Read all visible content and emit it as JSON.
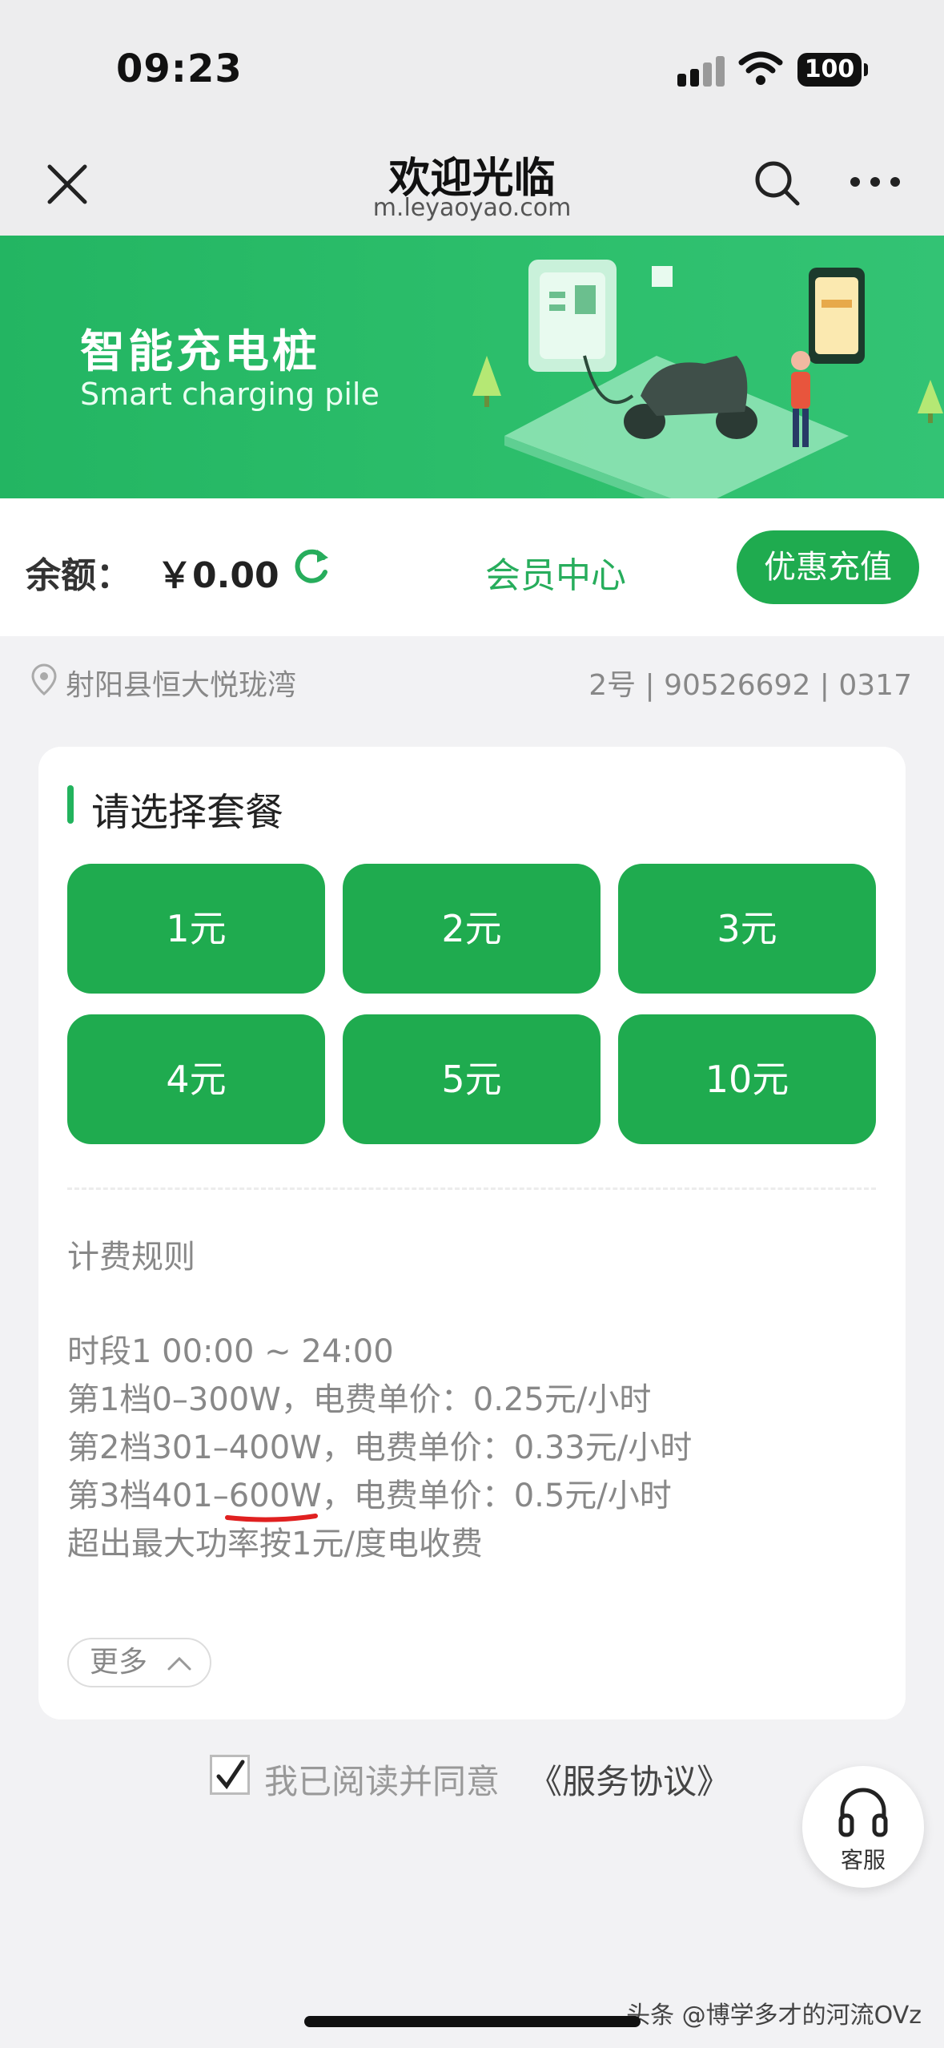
{
  "status_bar": {
    "time": "09:23",
    "battery": "100"
  },
  "nav": {
    "title": "欢迎光临",
    "url": "m.leyaoyao.com"
  },
  "banner": {
    "title": "智能充电桩",
    "subtitle": "Smart charging pile"
  },
  "balance": {
    "label": "余额：",
    "value": "￥0.00",
    "member_center": "会员中心",
    "recharge": "优惠充值"
  },
  "location": {
    "name": "射阳县恒大悦珑湾",
    "device": "2号 | 90526692 | 0317"
  },
  "packages": {
    "title": "请选择套餐",
    "items": [
      "1元",
      "2元",
      "3元",
      "4元",
      "5元",
      "10元"
    ]
  },
  "rules": {
    "title": "计费规则",
    "lines": [
      "时段1 00:00 ~ 24:00",
      "第1档0–300W，电费单价：0.25元/小时",
      "第2档301–400W，电费单价：0.33元/小时",
      "第3档401–600W，电费单价：0.5元/小时",
      "超出最大功率按1元/度电收费"
    ],
    "more": "更多"
  },
  "agreement": {
    "text": "我已阅读并同意",
    "link": "《服务协议》",
    "checked": true
  },
  "service": {
    "label": "客服"
  },
  "watermark": "头条 @博学多才的河流OVz",
  "colors": {
    "brand_green": "#1fab4f",
    "banner_green": "#2dbf6c",
    "text_gray": "#888888"
  }
}
